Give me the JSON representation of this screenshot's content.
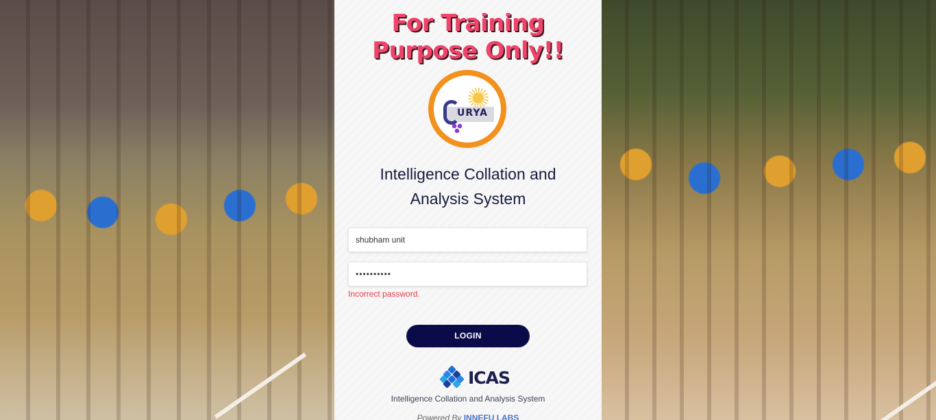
{
  "banner": {
    "line1": "For Training",
    "line2": "Purpose Only!!"
  },
  "logo": {
    "text": "URYA",
    "icon": "surya-logo-icon"
  },
  "app_title": {
    "line1": "Intelligence Collation and",
    "line2": "Analysis System"
  },
  "form": {
    "username_value": "shubham unit",
    "password_value": "••••••••••",
    "error": "Incorrect password.",
    "login_label": "LOGIN"
  },
  "footer": {
    "brand": "ICAS",
    "system_name": "Intelligence Collation and Analysis System",
    "powered_prefix": "Powered By",
    "powered_company": "INNEFU LABS"
  },
  "colors": {
    "banner": "#f0436a",
    "button": "#0b0b4a",
    "error": "#e8394c",
    "logo_ring": "#f2911e"
  }
}
